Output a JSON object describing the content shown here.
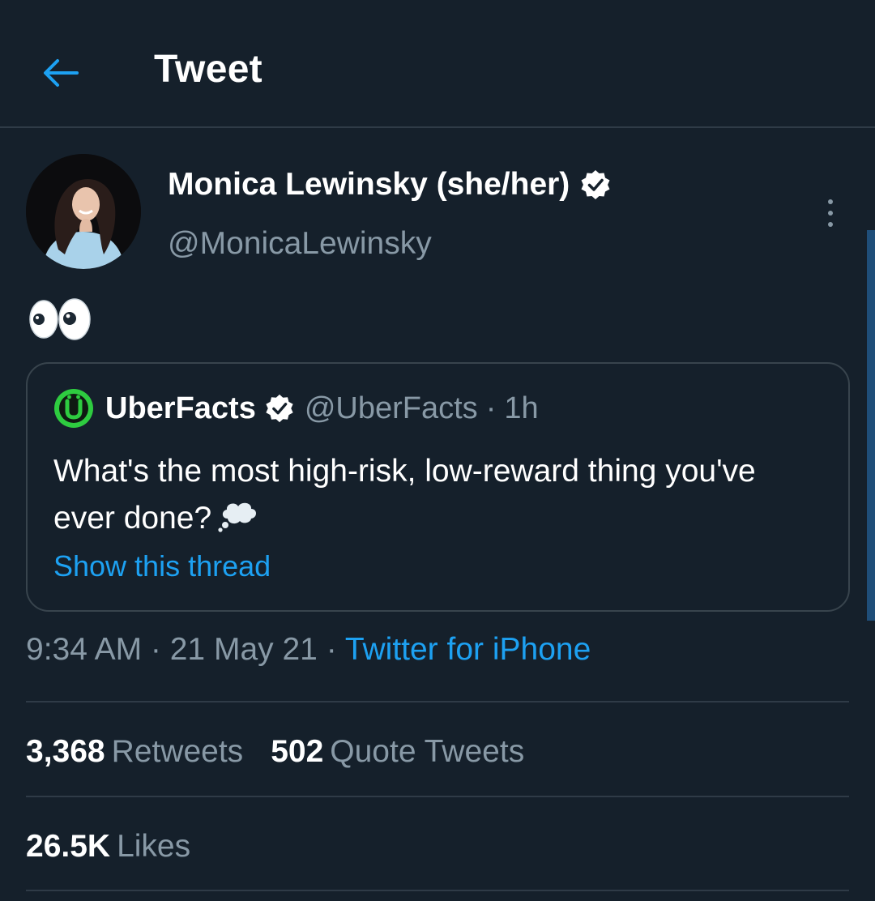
{
  "header": {
    "title": "Tweet"
  },
  "tweet": {
    "author_name": "Monica Lewinsky (she/her)",
    "author_handle": "@MonicaLewinsky",
    "body_emoji": "👀",
    "timestamp": "9:34 AM · 21 May 21 · ",
    "source": "Twitter for iPhone"
  },
  "quote": {
    "name": "UberFacts",
    "handle": "@UberFacts",
    "separator": "·",
    "time": "1h",
    "text": "What's the most high-risk, low-reward thing you've ever done?",
    "show_thread": "Show this thread"
  },
  "stats": {
    "retweets_count": "3,368",
    "retweets_label": "Retweets",
    "quotes_count": "502",
    "quotes_label": "Quote Tweets",
    "likes_count": "26.5K",
    "likes_label": "Likes"
  },
  "colors": {
    "background": "#15202b",
    "accent": "#1da1f2",
    "secondary_text": "#8899a6",
    "border": "#38444d",
    "uberfacts_green": "#2ecc40"
  }
}
